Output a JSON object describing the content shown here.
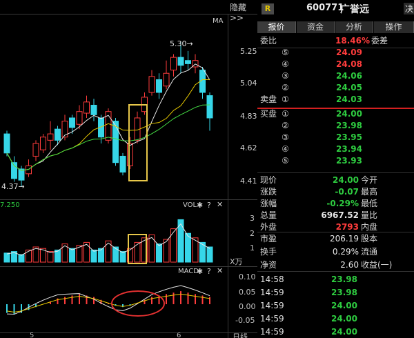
{
  "top": {
    "hide_label": "隐藏",
    "hide_arrow": ">>",
    "badge": "R",
    "code": "600771",
    "name": "广誉远",
    "decide": "决"
  },
  "tabs": [
    "报价",
    "资金",
    "分析",
    "操作"
  ],
  "weibi": {
    "label": "委比",
    "value": "18.46%",
    "label2": "委差"
  },
  "sell": [
    {
      "label": "",
      "n": "⑤",
      "price": "24.09"
    },
    {
      "label": "",
      "n": "④",
      "price": "24.08"
    },
    {
      "label": "",
      "n": "③",
      "price": "24.06"
    },
    {
      "label": "",
      "n": "②",
      "price": "24.05"
    },
    {
      "label": "卖盘",
      "n": "①",
      "price": "24.03"
    }
  ],
  "buy": [
    {
      "label": "买盘",
      "n": "①",
      "price": "24.00"
    },
    {
      "label": "",
      "n": "②",
      "price": "23.98"
    },
    {
      "label": "",
      "n": "③",
      "price": "23.95"
    },
    {
      "label": "",
      "n": "④",
      "price": "23.94"
    },
    {
      "label": "",
      "n": "⑤",
      "price": "23.93"
    }
  ],
  "quote1": [
    {
      "label": "现价",
      "value": "24.00",
      "label2": "今开",
      "color": "grn"
    },
    {
      "label": "涨跌",
      "value": "-0.07",
      "label2": "最高",
      "color": "grn"
    },
    {
      "label": "涨幅",
      "value": "-0.29%",
      "label2": "最低",
      "color": "grn"
    },
    {
      "label": "总量",
      "value": "6967.52",
      "label2": "量比",
      "color": "wht"
    },
    {
      "label": "外盘",
      "value": "2793",
      "label2": "内盘",
      "color": "red"
    }
  ],
  "quote2": [
    {
      "label": "市盈",
      "value": "206.19",
      "label2": "股本"
    },
    {
      "label": "换手",
      "value": "0.29%",
      "label2": "流通"
    },
    {
      "label": "净资",
      "value": "2.60",
      "label2": "收益(一)"
    }
  ],
  "ticks": [
    {
      "time": "14:58",
      "price": "23.98"
    },
    {
      "time": "14:59",
      "price": "23.98"
    },
    {
      "time": "14:59",
      "price": "24.00"
    },
    {
      "time": "14:59",
      "price": "24.00"
    },
    {
      "time": "14:59",
      "price": "24.00"
    }
  ],
  "chart_data": [
    {
      "type": "candlestick",
      "title": "MA",
      "y_ticks": [
        "5.25",
        "5.04",
        "4.83",
        "4.62",
        "4.41"
      ],
      "annotations": [
        "5.30",
        "4.37"
      ],
      "ylim": [
        4.37,
        5.3
      ]
    },
    {
      "type": "bar",
      "title": "VOL",
      "left_value": "7.250",
      "y_ticks": [
        "3",
        "2",
        "1"
      ],
      "unit": "X万"
    },
    {
      "type": "bar",
      "title": "MACD",
      "y_ticks": [
        "0.10",
        "0.05",
        "0.00",
        "-0.05"
      ]
    }
  ],
  "x_axis": {
    "labels": [
      "5",
      "6"
    ],
    "extra": "日线"
  },
  "colors": {
    "up": "#ff3c3c",
    "down": "#36d6e8",
    "ma1": "#e8e8e8",
    "ma2": "#e6c800",
    "ma3": "#44dd44",
    "highlight_box": "#e8c84a",
    "macd_ellipse": "#e03030"
  }
}
